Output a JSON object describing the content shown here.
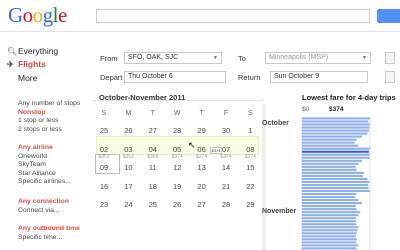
{
  "header": {
    "logo_letters": [
      {
        "ch": "G",
        "color": "#3369e8"
      },
      {
        "ch": "o",
        "color": "#d50f25"
      },
      {
        "ch": "o",
        "color": "#eeb211"
      },
      {
        "ch": "g",
        "color": "#3369e8"
      },
      {
        "ch": "l",
        "color": "#009925"
      },
      {
        "ch": "e",
        "color": "#d50f25"
      }
    ],
    "search_value": "",
    "accent": "#4d90fe"
  },
  "leftnav": {
    "everything": "Everything",
    "flights": "Flights",
    "more": "More",
    "stops": {
      "heading": "Any number of stops",
      "options": [
        "Nonstop",
        "1 stop or less",
        "2 stops or less"
      ]
    },
    "airline": {
      "heading": "Any airline",
      "options": [
        "Oneworld",
        "SkyTeam",
        "Star Alliance",
        "Specific airlines..."
      ]
    },
    "connection": {
      "heading": "Any connection",
      "options": [
        "Connect via..."
      ]
    },
    "outbound": {
      "heading": "Any outbound time",
      "options": [
        "Specific time..."
      ]
    }
  },
  "form": {
    "from_label": "From",
    "from_value": "SFO, OAK, SJC",
    "to_label": "To",
    "to_value": "Minneapolis (MSP)",
    "depart_label": "Depart",
    "depart_value": "Thu October 6",
    "return_label": "Return",
    "return_value": "Sun October 9"
  },
  "calendar": {
    "title": "October-November 2011",
    "weekdays": [
      "S",
      "M",
      "T",
      "W",
      "T",
      "F",
      "S"
    ],
    "weeks": [
      {
        "days": [
          "25",
          "26",
          "27",
          "28",
          "29",
          "30",
          "1"
        ],
        "fares": [
          "",
          "",
          "",
          "",
          "",
          "",
          ""
        ]
      },
      {
        "days": [
          "02",
          "03",
          "04",
          "05",
          "06",
          "07",
          "08"
        ],
        "fares": [
          "$352",
          "$352",
          "$359",
          "$374",
          "$374",
          "$374",
          "$374"
        ]
      },
      {
        "days": [
          "09",
          "10",
          "11",
          "12",
          "13",
          "14",
          "15"
        ],
        "fares": [
          "",
          "",
          "",
          "",
          "",
          "",
          ""
        ]
      },
      {
        "days": [
          "16",
          "17",
          "18",
          "19",
          "20",
          "21",
          "22"
        ],
        "fares": [
          "",
          "",
          "",
          "",
          "",
          "",
          ""
        ]
      },
      {
        "days": [
          "23",
          "24",
          "25",
          "26",
          "27",
          "28",
          "29"
        ],
        "fares": [
          "",
          "",
          "",
          "",
          "",
          "",
          ""
        ]
      }
    ],
    "hover_badge": "$374"
  },
  "fare_chart": {
    "title": "Lowest fare for 4-day trips",
    "x_ticks": [
      "$0",
      "$374"
    ],
    "months": [
      "October",
      "November"
    ]
  },
  "chart_data": {
    "type": "bar",
    "title": "Lowest fare for 4-day trips",
    "orientation": "horizontal",
    "xlim": [
      0,
      374
    ],
    "x_ticks": [
      "$0",
      "$374"
    ],
    "groups": [
      "October",
      "November"
    ],
    "values": [
      380,
      365,
      372,
      370,
      368,
      360,
      330,
      300,
      290,
      310,
      372,
      368,
      374,
      372,
      330,
      310,
      295,
      300,
      340,
      335,
      360,
      370,
      364,
      366,
      372,
      300,
      290,
      310,
      330,
      295,
      300,
      320,
      310,
      298,
      296,
      300,
      310,
      305,
      300,
      296,
      302,
      298,
      310,
      300
    ],
    "color": "#8fb0ea",
    "highlight_color": "#3b5fcf"
  }
}
